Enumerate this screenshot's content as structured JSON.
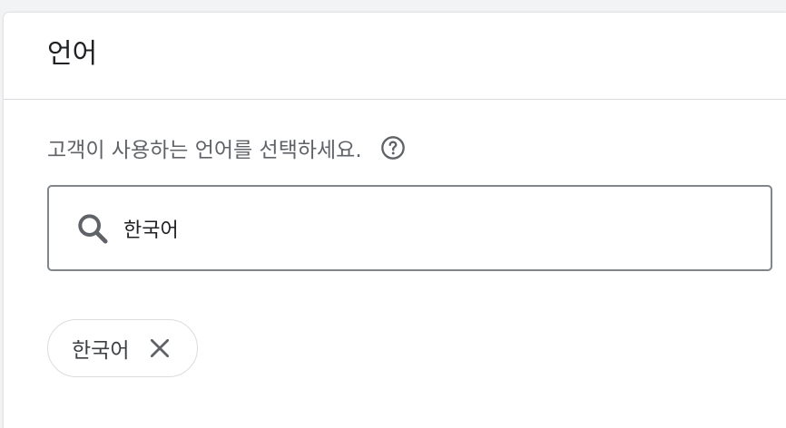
{
  "section": {
    "title": "언어",
    "description": "고객이 사용하는 언어를 선택하세요."
  },
  "search": {
    "value": "한국어",
    "placeholder": ""
  },
  "selected_chips": [
    {
      "label": "한국어"
    }
  ],
  "icons": {
    "help": "help-circle-icon",
    "search": "search-icon",
    "chip_remove": "close-icon"
  },
  "colors": {
    "title_text": "#202124",
    "secondary_text": "#5f6368",
    "border": "#80868b",
    "divider": "#dadce0"
  }
}
